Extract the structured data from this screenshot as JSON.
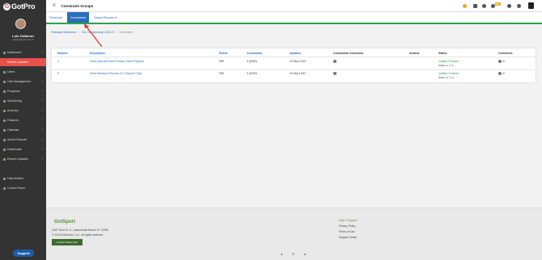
{
  "sidebar": {
    "logo_text": "GotPro",
    "user_name": "Luis Calderon",
    "user_email": "lcalder@cyfc.com ▾",
    "items": [
      {
        "label": "Dashboard",
        "chev": "›"
      },
      {
        "label": "Recent Updates",
        "chev": ""
      },
      {
        "label": "Users",
        "chev": "›"
      },
      {
        "label": "Club Management",
        "chev": "›"
      },
      {
        "label": "Programs",
        "chev": "›"
      },
      {
        "label": "Scheduling",
        "chev": "›"
      },
      {
        "label": "Archives",
        "chev": "›"
      },
      {
        "label": "Features",
        "chev": "›"
      },
      {
        "label": "Calendar",
        "chev": "›"
      },
      {
        "label": "Saved Reports",
        "chev": "›"
      },
      {
        "label": "Downloads",
        "chev": "›"
      },
      {
        "label": "Recent Updates",
        "chev": "›"
      },
      {
        "label": "Help Articles",
        "chev": ""
      },
      {
        "label": "Control Panel",
        "chev": ""
      }
    ],
    "support_label": "Support"
  },
  "topbar": {
    "title": "Constraint Groups",
    "menu_icon": "≡",
    "badge": "99+"
  },
  "tabs": [
    {
      "label": "Schedule"
    },
    {
      "label": "Constraints"
    },
    {
      "label": "Saved Reports ▾"
    }
  ],
  "breadcrumb": {
    "item1": "Participant Schedules",
    "sep": "/",
    "item2": "CDL Championship 2024-25",
    "item3": "Constraints"
  },
  "table": {
    "headers": {
      "number": "Number",
      "description": "Description",
      "points": "Points",
      "constraints": "Constraints",
      "updated": "Updated",
      "comments_col": "Constraints Comments",
      "actions": "Actions",
      "status": "Status",
      "comments": "Comments"
    },
    "rows": [
      {
        "number": "1",
        "description": "Home Special Event Primary Home Request",
        "points": "999",
        "constraints": "0 (0/0/0)",
        "updated": "19 Sep 13:03",
        "status": "Quality Checked",
        "status2": "Status: ● ◯ ●",
        "comment_chev": "▾"
      },
      {
        "number": "2",
        "description": "Home Blackout Rounds (14 Total per Club)",
        "points": "999",
        "constraints": "0 (0/0/0)",
        "updated": "19 Sep 14:57",
        "status": "Quality Checked",
        "status2": "Status: ● ◯ ●",
        "comment_chev": "▾"
      }
    ]
  },
  "footer": {
    "logo": "GotSport",
    "address": "1520 Third St. S., Jacksonville Beach, FL 32250",
    "copyright": "© 2025 GotSoccer, LLC. All rights reserved.",
    "pref_button": "Cookie Preferences",
    "help": "Help & Support",
    "privacy": "Privacy Policy",
    "terms": "Terms of Use",
    "support_center": "Support Center"
  },
  "pager": {
    "prev": "◂",
    "dot": "⊙",
    "next": "▸"
  },
  "colors": {
    "accent": "#2a6ebb",
    "sidebar_active": "#e7514a",
    "tab_underline": "#2ba34a",
    "arrow": "#d93025"
  }
}
